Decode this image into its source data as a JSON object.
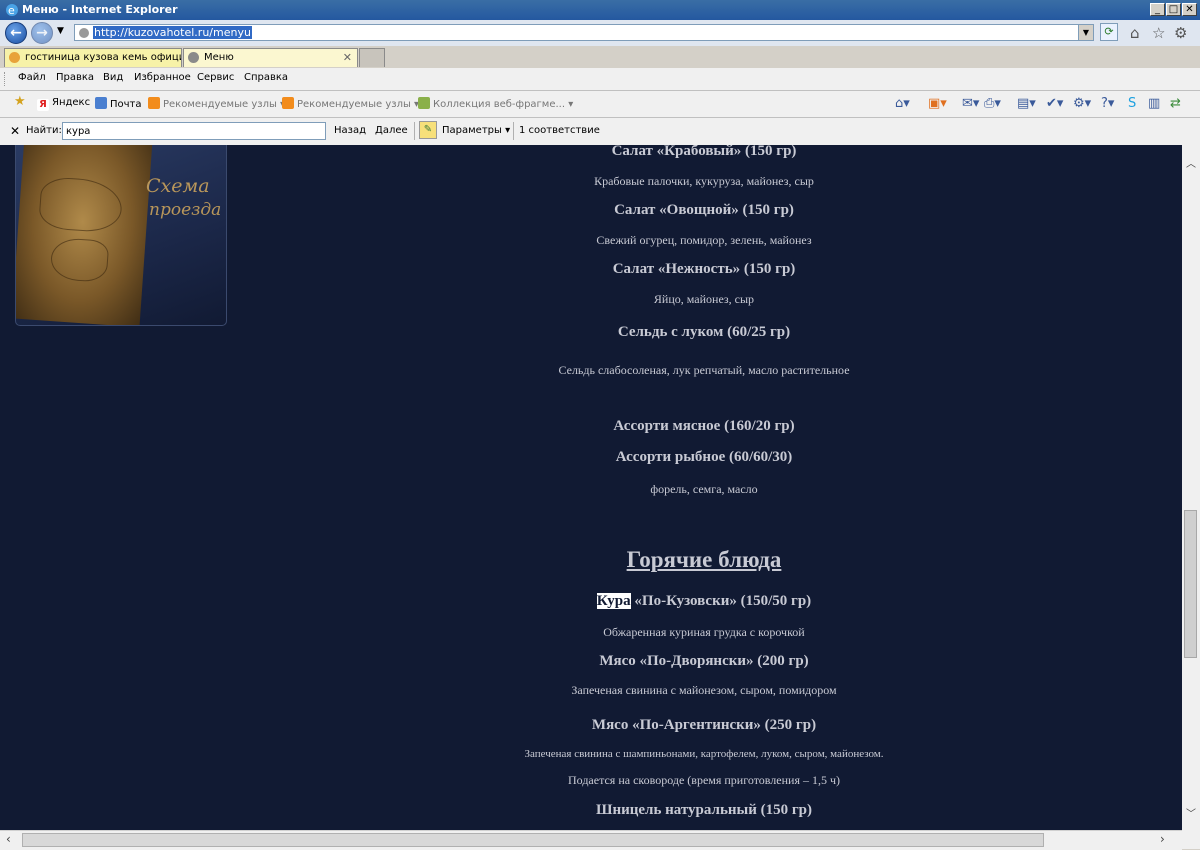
{
  "window": {
    "title": "Меню - Internet Explorer",
    "controls": [
      "_",
      "□",
      "✕"
    ]
  },
  "address": {
    "url": "http://kuzovahotel.ru/menyu"
  },
  "tabs": [
    {
      "label": "гостиница кузова кемь офици...",
      "icon_color": "#e8a33a"
    },
    {
      "label": "Меню",
      "icon_color": "#8a8a8a",
      "close": "✕"
    }
  ],
  "menubar": [
    "Файл",
    "Правка",
    "Вид",
    "Избранное",
    "Сервис",
    "Справка"
  ],
  "favorites": [
    {
      "label": "Яндекс",
      "icon": "yandex-icon"
    },
    {
      "label": "Почта",
      "icon": "mail-icon"
    },
    {
      "label": "Рекомендуемые узлы",
      "icon": "rss-icon"
    },
    {
      "label": "Рекомендуемые узлы",
      "icon": "rss-icon"
    },
    {
      "label": "Коллекция веб-фрагме...",
      "icon": "webslice-icon"
    }
  ],
  "findbar": {
    "close": "✕",
    "label": "Найти:",
    "query": "кура",
    "prev": "Назад",
    "next": "Далее",
    "options": "Параметры",
    "result": "1 соответствие"
  },
  "sidebar": {
    "map_caption_1": "Схема",
    "map_caption_2": "проезда"
  },
  "menu_items": [
    {
      "type": "name",
      "text": "Салат «Крабовый» (150 гр)"
    },
    {
      "type": "desc",
      "text": "Крабовые палочки, кукуруза, майонез, сыр"
    },
    {
      "type": "name",
      "text": "Салат «Овощной» (150 гр)"
    },
    {
      "type": "desc",
      "text": "Свежий огурец, помидор, зелень, майонез"
    },
    {
      "type": "name",
      "text": "Салат «Нежность» (150 гр)"
    },
    {
      "type": "desc",
      "text": "Яйцо, майонез, сыр"
    },
    {
      "type": "name",
      "text": "Сельдь с луком (60/25 гр)"
    },
    {
      "type": "desc",
      "text": "Сельдь слабосоленая, лук репчатый, масло растительное"
    },
    {
      "type": "name",
      "text": "Ассорти мясное (160/20 гр)"
    },
    {
      "type": "name",
      "text": "Ассорти рыбное (60/60/30)"
    },
    {
      "type": "desc",
      "text": "форель, семга, масло"
    },
    {
      "type": "section",
      "text": "Горячие блюда"
    },
    {
      "type": "name",
      "highlight": "Кура",
      "text": " «По-Кузовски» (150/50 гр)"
    },
    {
      "type": "desc",
      "text": "Обжаренная куриная грудка с корочкой"
    },
    {
      "type": "name",
      "text": "Мясо «По-Дворянски» (200 гр)"
    },
    {
      "type": "desc",
      "text": "Запеченая свинина с майонезом, сыром, помидором"
    },
    {
      "type": "name",
      "text": "Мясо «По-Аргентински» (250 гр)"
    },
    {
      "type": "small",
      "text": "Запеченая свинина с шампиньонами, картофелем, луком, сыром, майонезом."
    },
    {
      "type": "desc",
      "text": "Подается на сковороде (время приготовления – 1,5 ч)"
    },
    {
      "type": "name",
      "text": "Шницель натуральный (150 гр)"
    }
  ],
  "colors": {
    "page_bg": "#111a33",
    "text": "#c8cad4",
    "highlight_bg": "#ffffff"
  }
}
